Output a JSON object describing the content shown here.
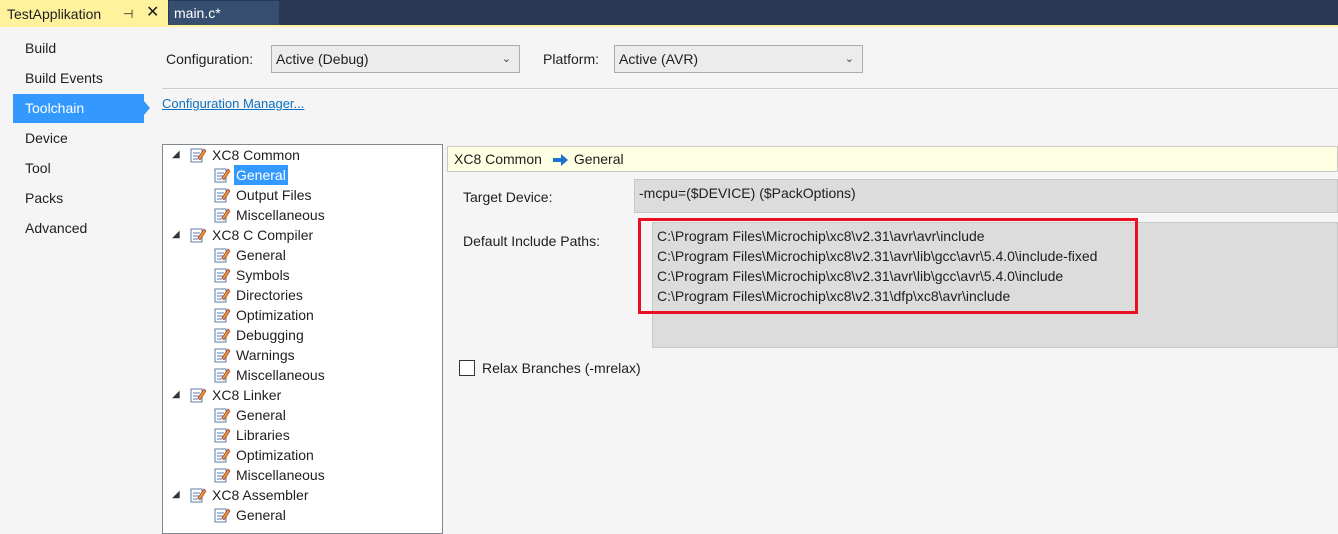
{
  "tabs": {
    "active": "TestApplikation",
    "inactive": "main.c*",
    "pin_glyph": "⊣",
    "close_glyph": "✕"
  },
  "nav": {
    "items": [
      "Build",
      "Build Events",
      "Toolchain",
      "Device",
      "Tool",
      "Packs",
      "Advanced"
    ],
    "selected": "Toolchain"
  },
  "config": {
    "configuration_label": "Configuration:",
    "configuration_value": "Active (Debug)",
    "platform_label": "Platform:",
    "platform_value": "Active (AVR)",
    "manager_link": "Configuration Manager..."
  },
  "tree": {
    "groups": [
      {
        "label": "XC8 Common",
        "children": [
          "General",
          "Output Files",
          "Miscellaneous"
        ]
      },
      {
        "label": "XC8 C Compiler",
        "children": [
          "General",
          "Symbols",
          "Directories",
          "Optimization",
          "Debugging",
          "Warnings",
          "Miscellaneous"
        ]
      },
      {
        "label": "XC8 Linker",
        "children": [
          "General",
          "Libraries",
          "Optimization",
          "Miscellaneous"
        ]
      },
      {
        "label": "XC8 Assembler",
        "children": [
          "General"
        ]
      }
    ],
    "selected": "XC8 Common / General"
  },
  "props": {
    "header_group": "XC8 Common",
    "header_page": "General",
    "target_device_label": "Target Device:",
    "target_device_value": "-mcpu=($DEVICE) ($PackOptions)",
    "include_paths_label": "Default Include Paths:",
    "include_paths": [
      "C:\\Program Files\\Microchip\\xc8\\v2.31\\avr\\avr\\include",
      "C:\\Program Files\\Microchip\\xc8\\v2.31\\avr\\lib\\gcc\\avr\\5.4.0\\include-fixed",
      "C:\\Program Files\\Microchip\\xc8\\v2.31\\avr\\lib\\gcc\\avr\\5.4.0\\include",
      "C:\\Program Files\\Microchip\\xc8\\v2.31\\dfp\\xc8\\avr\\include"
    ],
    "relax_label": "Relax Branches (-mrelax)",
    "relax_checked": false
  },
  "colors": {
    "tab_active": "#fff29d",
    "selection": "#3399ff",
    "highlight_box": "#e81123"
  }
}
